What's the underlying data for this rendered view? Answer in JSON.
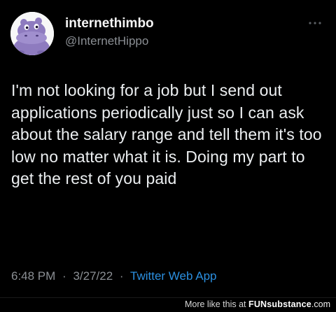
{
  "tweet": {
    "display_name": "internethimbo",
    "handle": "@InternetHippo",
    "avatar_icon": "hippo-avatar-icon",
    "more_icon": "more-options-icon",
    "text": "I'm not looking for a job but I send out applications periodically just so I can ask about the salary range and tell them it's too low no matter what it is. Doing my part to get the rest of you paid",
    "time": "6:48 PM",
    "separator": "·",
    "date": "3/27/22",
    "source": "Twitter Web App"
  },
  "footer": {
    "more_like_this": "More like this at",
    "brand_main": "FUNsubstance",
    "brand_domain": ".com"
  },
  "colors": {
    "background": "#000000",
    "text": "#eceff1",
    "muted": "#8b8f94",
    "link": "#2b8fe0",
    "avatar_hippo": "#8e7bbf"
  }
}
